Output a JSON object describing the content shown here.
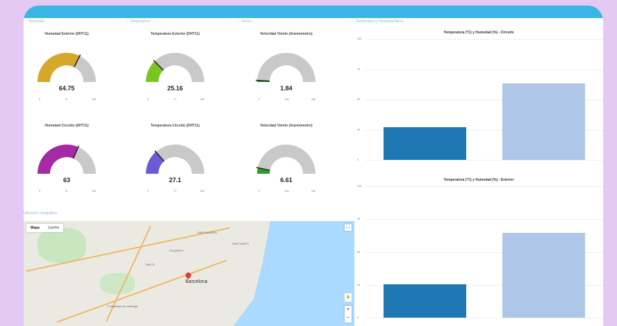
{
  "sections": {
    "humidity": "Humedad",
    "temperature": "Temperatura",
    "wind": "Viento",
    "chart_section": "Temperatura y Humedad Barra",
    "map_section": "Ubicación Geográfica"
  },
  "gauges": [
    {
      "title": "Humedad Exterior (DHT11)",
      "value": "64.75",
      "min": "0",
      "max": "100",
      "unit": "%",
      "level": 0.6475,
      "color": "#d5a82a"
    },
    {
      "title": "Temperatura Exterior (DHT11)",
      "value": "25.16",
      "min": "0",
      "max": "100",
      "unit": "°C",
      "level": 0.2516,
      "color": "#7ac520"
    },
    {
      "title": "Velocidad Viento (Anemometro)",
      "value": "1.84",
      "min": "0",
      "max": "100",
      "unit": "m/s",
      "level": 0.0184,
      "color": "#2aa02a"
    },
    {
      "title": "Humedad Circuito (DHT11)",
      "value": "63",
      "min": "0",
      "max": "100",
      "unit": "%",
      "level": 0.63,
      "color": "#a52aa5"
    },
    {
      "title": "Temperatura Circuito (DHT11)",
      "value": "27.1",
      "min": "0",
      "max": "100",
      "unit": "°C",
      "level": 0.271,
      "color": "#6b5bd6"
    },
    {
      "title": "Velocidad Viento (Anemometro)",
      "value": "6.61",
      "min": "0",
      "max": "100",
      "unit": "m/s",
      "level": 0.0661,
      "color": "#2aa02a"
    }
  ],
  "map": {
    "tabs": [
      "Mapa",
      "Satélite"
    ],
    "city": "Barcelona",
    "labels": [
      "L'Hospitalet de Llobregat",
      "SANTS",
      "SANT MARTÍ",
      "EIXAMPLE",
      "SANT ANDREU"
    ]
  },
  "chart_data": [
    {
      "type": "bar",
      "title": "Temperatura (°C) y Humedad (%) - Circuito",
      "ylim": [
        0,
        100
      ],
      "yticks": [
        "0",
        "25",
        "50",
        "75",
        "100"
      ],
      "series": [
        {
          "values": [
            27.1
          ],
          "color": "#1f77b4"
        },
        {
          "values": [
            63
          ],
          "color": "#aec7e8"
        }
      ]
    },
    {
      "type": "bar",
      "title": "Temperatura (°C) y Humedad (%) - Exterior",
      "ylim": [
        0,
        100
      ],
      "yticks": [
        "0",
        "25",
        "50",
        "75",
        "100"
      ],
      "series": [
        {
          "values": [
            25.16
          ],
          "color": "#1f77b4"
        },
        {
          "values": [
            64.75
          ],
          "color": "#aec7e8"
        }
      ]
    }
  ]
}
